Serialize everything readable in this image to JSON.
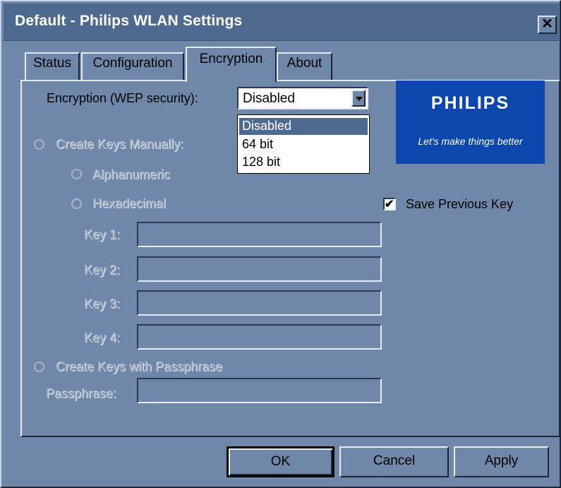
{
  "window": {
    "title": "Default - Philips WLAN Settings",
    "close_label": "✕"
  },
  "tabs": [
    {
      "label": "Status",
      "active": false
    },
    {
      "label": "Configuration",
      "active": false
    },
    {
      "label": "Encryption",
      "active": true
    },
    {
      "label": "About",
      "active": false
    }
  ],
  "encryption": {
    "label": "Encryption (WEP security):",
    "selected": "Disabled",
    "options": [
      "Disabled",
      "64 bit",
      "128 bit"
    ]
  },
  "logo": {
    "brand": "PHILIPS",
    "slogan": "Let's make things better"
  },
  "manual": {
    "label": "Create Keys Manually:",
    "alphanumeric": "Alphanumeric",
    "hexadecimal": "Hexadecimal"
  },
  "save_previous_key": {
    "label": "Save Previous Key",
    "checked": true
  },
  "keys": [
    {
      "label": "Key 1:",
      "value": ""
    },
    {
      "label": "Key 2:",
      "value": ""
    },
    {
      "label": "Key 3:",
      "value": ""
    },
    {
      "label": "Key 4:",
      "value": ""
    }
  ],
  "passphrase": {
    "radio_label": "Create Keys with Passphrase",
    "field_label": "Passphrase:",
    "value": ""
  },
  "buttons": {
    "ok": "OK",
    "cancel": "Cancel",
    "apply": "Apply"
  },
  "colors": {
    "background": "#6f87a8",
    "titlebar": "#4e6a8f",
    "logo_blue": "#0b47ad",
    "disabled_text": "#a9b5c5"
  }
}
